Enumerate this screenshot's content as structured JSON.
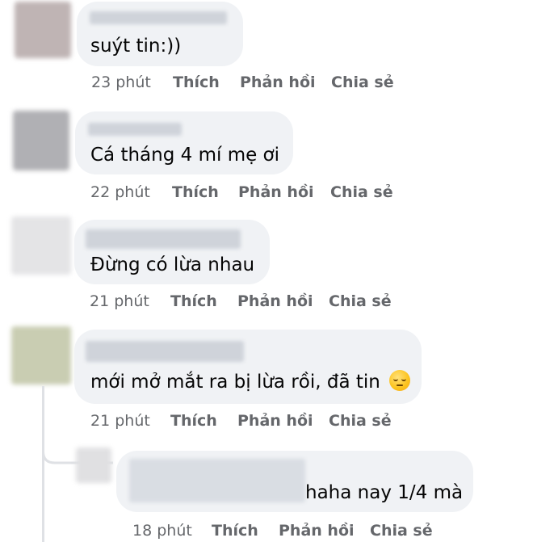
{
  "comments": [
    {
      "text": "suýt tin:))",
      "time": "23 phút",
      "like_label": "Thích",
      "reply_label": "Phản hồi",
      "share_label": "Chia sẻ"
    },
    {
      "text": "Cá tháng 4 mí mẹ ơi",
      "time": "22 phút",
      "like_label": "Thích",
      "reply_label": "Phản hồi",
      "share_label": "Chia sẻ"
    },
    {
      "text": "Đừng có lừa nhau",
      "time": "21 phút",
      "like_label": "Thích",
      "reply_label": "Phản hồi",
      "share_label": "Chia sẻ"
    },
    {
      "text": "mới mở mắt ra bị lừa rồi, đã tin",
      "emoji": "pensive-face-emoji",
      "time": "21 phút",
      "like_label": "Thích",
      "reply_label": "Phản hồi",
      "share_label": "Chia sẻ"
    },
    {
      "text": "haha nay 1/4 mà",
      "time": "18 phút",
      "like_label": "Thích",
      "reply_label": "Phản hồi",
      "share_label": "Chia sẻ",
      "is_reply": true
    }
  ],
  "colors": {
    "bubble": "#f0f2f5",
    "action_text": "#65676b",
    "comment_text": "#050505"
  }
}
